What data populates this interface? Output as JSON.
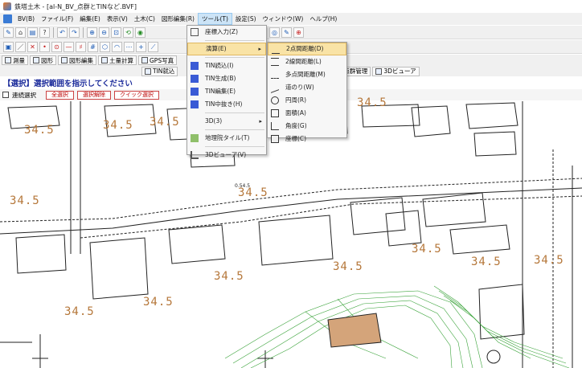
{
  "window": {
    "title": "鉄塔土木 - [al-N_BV_点群とTINなど.BVF]"
  },
  "menubar": {
    "items": [
      "BV(B)",
      "ファイル(F)",
      "編集(E)",
      "表示(V)",
      "土木(C)",
      "図形編集(R)",
      "ツール(T)",
      "設定(S)",
      "ウィンドウ(W)",
      "ヘルプ(H)"
    ]
  },
  "tabs": {
    "row1": [
      "測量",
      "図形",
      "図形編集",
      "土量計算",
      "GPS写真"
    ],
    "row2": [
      "TIN就込",
      "点群管理",
      "3Dビューア"
    ]
  },
  "prompt": "【選択】選択範囲を指示してください",
  "selection_bar": {
    "continuous_label": "連続選択",
    "buttons": [
      "全選択",
      "選択解除",
      "クイック選択"
    ]
  },
  "tools_menu": {
    "items": [
      {
        "label": "座標入力(Z)",
        "icon": "coord-icon"
      },
      {
        "label": "演算(E)",
        "icon": "",
        "submenu": true
      },
      {
        "label": "TIN読込(I)",
        "icon": "tin-icon"
      },
      {
        "label": "TIN生成(B)",
        "icon": "tin-icon"
      },
      {
        "label": "TIN編集(E)",
        "icon": "tin-icon"
      },
      {
        "label": "TIN中抜き(H)",
        "icon": "tin-icon"
      },
      {
        "label": "3D(3)",
        "icon": "",
        "submenu": true
      },
      {
        "label": "地理院タイル(T)",
        "icon": "map-icon"
      },
      {
        "label": "3Dビューア(V)",
        "icon": "viewer-icon"
      }
    ]
  },
  "calc_submenu": {
    "items": [
      {
        "label": "2点間距離(D)"
      },
      {
        "label": "2線間距離(L)"
      },
      {
        "label": "多点間距離(M)"
      },
      {
        "label": "道のり(W)"
      },
      {
        "label": "円周(R)"
      },
      {
        "label": "面積(A)"
      },
      {
        "label": "角度(G)"
      },
      {
        "label": "座標(C)"
      }
    ]
  },
  "elevation_labels": [
    "34.5",
    "34.5",
    "34.5",
    "34.5",
    "34.5",
    "34.5",
    "34.5",
    "34.5",
    "34.5",
    "34.5",
    "34.5",
    "34.5",
    "34.5"
  ],
  "small_label": "0.54.5",
  "colors": {
    "elevation": "#b5773a",
    "highlight": "#f9e3a6",
    "contour": "#3aa33a",
    "building": "#d4a47a"
  }
}
